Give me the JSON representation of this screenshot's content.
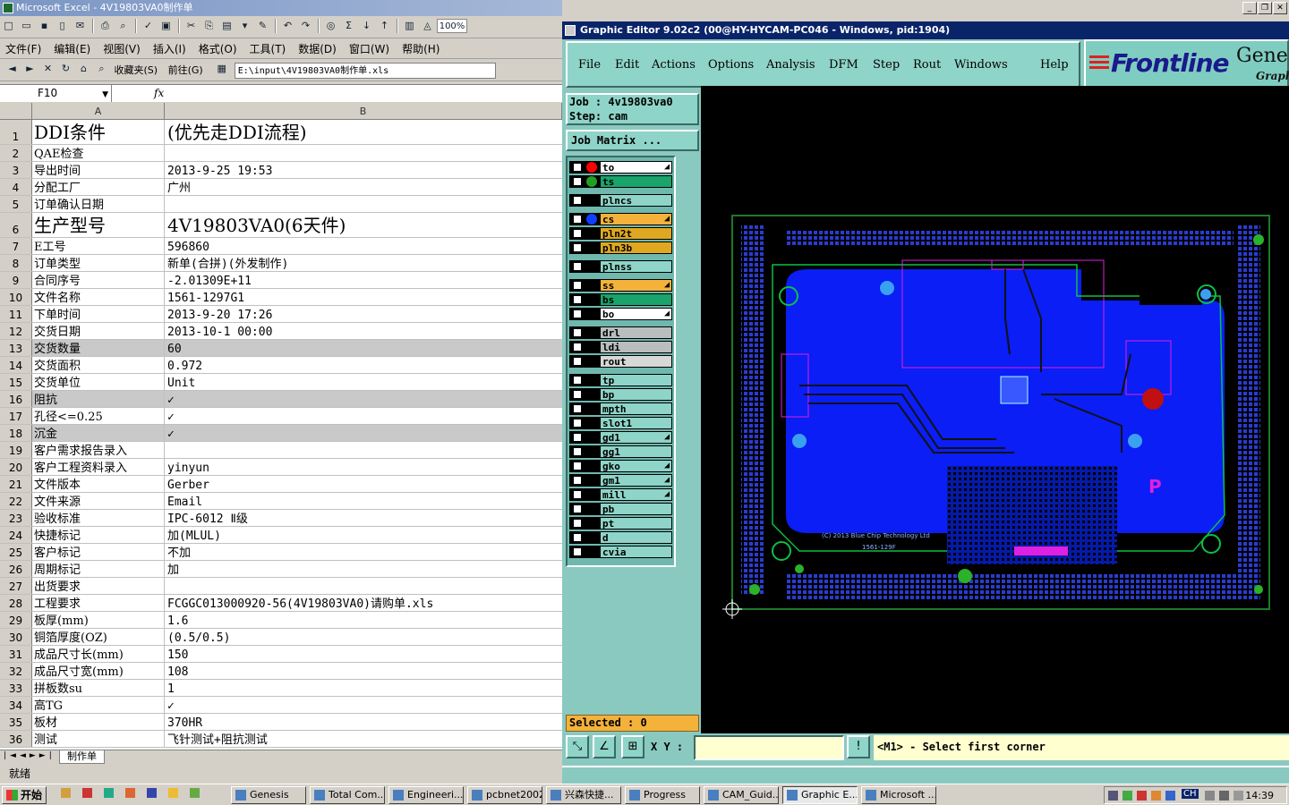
{
  "excel": {
    "title": "Microsoft Excel - 4V19803VA0制作单",
    "zoom": "100%",
    "menu": [
      "文件(F)",
      "编辑(E)",
      "视图(V)",
      "插入(I)",
      "格式(O)",
      "工具(T)",
      "数据(D)",
      "窗口(W)",
      "帮助(H)"
    ],
    "web_toolbar": {
      "favorites": "收藏夹(S)",
      "goto": "前往(G)",
      "address": "E:\\input\\4V19803VA0制作单.xls"
    },
    "namebox": "F10",
    "fx": "fx",
    "columns": [
      "A",
      "B"
    ],
    "rows": [
      {
        "n": "1",
        "a": "DDI条件",
        "b": "(优先走DDI流程)"
      },
      {
        "n": "2",
        "a": "QAE检查",
        "b": ""
      },
      {
        "n": "3",
        "a": "导出时间",
        "b": "2013-9-25 19:53"
      },
      {
        "n": "4",
        "a": "分配工厂",
        "b": "广州"
      },
      {
        "n": "5",
        "a": "订单确认日期",
        "b": ""
      },
      {
        "n": "6",
        "a": "生产型号",
        "b": "4V19803VA0(6天件)"
      },
      {
        "n": "7",
        "a": "E工号",
        "b": "596860"
      },
      {
        "n": "8",
        "a": "订单类型",
        "b": "新单(合拼)(外发制作)"
      },
      {
        "n": "9",
        "a": "合同序号",
        "b": "-2.01309E+11"
      },
      {
        "n": "10",
        "a": "文件名称",
        "b": "1561-1297G1"
      },
      {
        "n": "11",
        "a": "下单时间",
        "b": "2013-9-20 17:26"
      },
      {
        "n": "12",
        "a": "交货日期",
        "b": "2013-10-1 00:00"
      },
      {
        "n": "13",
        "a": "交货数量",
        "b": "60"
      },
      {
        "n": "14",
        "a": "交货面积",
        "b": "0.972"
      },
      {
        "n": "15",
        "a": "交货单位",
        "b": "Unit"
      },
      {
        "n": "16",
        "a": "阻抗",
        "b": "✓"
      },
      {
        "n": "17",
        "a": "孔径<=0.25",
        "b": "✓"
      },
      {
        "n": "18",
        "a": "沉金",
        "b": "✓"
      },
      {
        "n": "19",
        "a": "客户需求报告录入",
        "b": ""
      },
      {
        "n": "20",
        "a": "客户工程资料录入",
        "b": "yinyun"
      },
      {
        "n": "21",
        "a": "文件版本",
        "b": "Gerber"
      },
      {
        "n": "22",
        "a": "文件来源",
        "b": "Email"
      },
      {
        "n": "23",
        "a": "验收标准",
        "b": "IPC-6012 Ⅱ级"
      },
      {
        "n": "24",
        "a": "快捷标记",
        "b": "加(MLUL)"
      },
      {
        "n": "25",
        "a": "客户标记",
        "b": "不加"
      },
      {
        "n": "26",
        "a": "周期标记",
        "b": "加"
      },
      {
        "n": "27",
        "a": "出货要求",
        "b": ""
      },
      {
        "n": "28",
        "a": "工程要求",
        "b": "FCGGC013000920-56(4V19803VA0)请购单.xls"
      },
      {
        "n": "29",
        "a": "板厚(mm)",
        "b": "1.6"
      },
      {
        "n": "30",
        "a": "铜箔厚度(OZ)",
        "b": "(0.5/0.5)"
      },
      {
        "n": "31",
        "a": "成品尺寸长(mm)",
        "b": "150"
      },
      {
        "n": "32",
        "a": "成品尺寸宽(mm)",
        "b": "108"
      },
      {
        "n": "33",
        "a": "拼板数su",
        "b": "1"
      },
      {
        "n": "34",
        "a": "高TG",
        "b": "✓"
      },
      {
        "n": "35",
        "a": "板材",
        "b": "370HR"
      },
      {
        "n": "36",
        "a": "测试",
        "b": "飞针测试+阻抗测试"
      }
    ],
    "sheet_tab": "制作单",
    "status": "就绪"
  },
  "genesis": {
    "title": "Graphic Editor 9.02c2 (00@HY-HYCAM-PC046 - Windows, pid:1904)",
    "menu": [
      "File",
      "Edit",
      "Actions",
      "Options",
      "Analysis",
      "DFM",
      "Step",
      "Rout",
      "Windows",
      "Help"
    ],
    "logo": "Frontline",
    "logo_suffix": "Genes",
    "logo_sub": "Graph",
    "job_line": "Job : 4v19803va0",
    "step_line": "Step: cam",
    "job_matrix": "Job Matrix ...",
    "layers": [
      {
        "name": "to",
        "color": "#ffffff",
        "dot": "#ff0000",
        "edit": true
      },
      {
        "name": "ts",
        "color": "#1aa36a",
        "dot": "#20a020",
        "edit": false
      },
      {
        "name": "plncs",
        "color": "#8fd4c8",
        "edit": false
      },
      {
        "name": "cs",
        "color": "#f4b23a",
        "dot": "#1040ff",
        "edit": true
      },
      {
        "name": "pln2t",
        "color": "#e0a820",
        "edit": false
      },
      {
        "name": "pln3b",
        "color": "#e0a820",
        "edit": false
      },
      {
        "name": "plnss",
        "color": "#8fd4c8",
        "edit": false
      },
      {
        "name": "ss",
        "color": "#f4b23a",
        "edit": true
      },
      {
        "name": "bs",
        "color": "#1aa36a",
        "edit": false
      },
      {
        "name": "bo",
        "color": "#ffffff",
        "edit": true
      },
      {
        "name": "drl",
        "color": "#b9bdbd",
        "edit": false
      },
      {
        "name": "ldi",
        "color": "#b9bdbd",
        "edit": false
      },
      {
        "name": "rout",
        "color": "#d8d8d8",
        "edit": false
      },
      {
        "name": "tp",
        "color": "#8fd4c8",
        "edit": false
      },
      {
        "name": "bp",
        "color": "#8fd4c8",
        "edit": false
      },
      {
        "name": "mpth",
        "color": "#8fd4c8",
        "edit": false
      },
      {
        "name": "slot1",
        "color": "#8fd4c8",
        "edit": false
      },
      {
        "name": "gd1",
        "color": "#8fd4c8",
        "edit": true
      },
      {
        "name": "gg1",
        "color": "#8fd4c8",
        "edit": false
      },
      {
        "name": "gko",
        "color": "#8fd4c8",
        "edit": true
      },
      {
        "name": "gm1",
        "color": "#8fd4c8",
        "edit": true
      },
      {
        "name": "mill",
        "color": "#8fd4c8",
        "edit": true
      },
      {
        "name": "pb",
        "color": "#8fd4c8",
        "edit": false
      },
      {
        "name": "pt",
        "color": "#8fd4c8",
        "edit": false
      },
      {
        "name": "d",
        "color": "#8fd4c8",
        "edit": false
      },
      {
        "name": "cvia",
        "color": "#8fd4c8",
        "edit": false
      }
    ],
    "selected": "Selected : 0",
    "xy_label": "X Y :",
    "message": "<M1> - Select first corner",
    "pcb_text": "(C) 2013 Blue Chip Technology Ltd",
    "pcb_part": "1561-129F"
  },
  "taskbar": {
    "start": "开始",
    "tasks": [
      "Genesis",
      "Total Com...",
      "Engineeri...",
      "pcbnet2002",
      "兴森快捷...",
      "Progress",
      "CAM_Guid...",
      "Graphic E...",
      "Microsoft ..."
    ],
    "clock": "14:39",
    "ime": "CH"
  }
}
